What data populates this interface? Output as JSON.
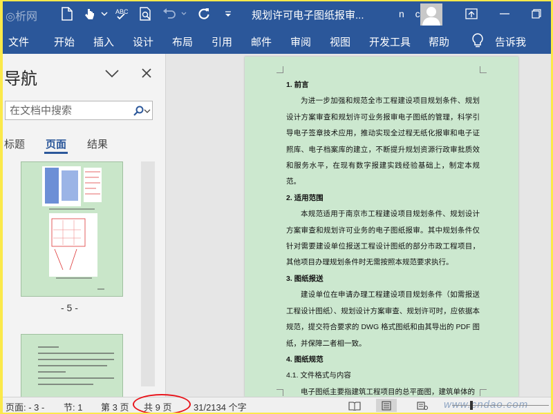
{
  "titlebar": {
    "doc_title": "规划许可电子图纸报审...",
    "user_initials": "n c",
    "logo_watermark": "◎析网"
  },
  "ribbon": {
    "tabs": [
      "文件",
      "开始",
      "插入",
      "设计",
      "布局",
      "引用",
      "邮件",
      "审阅",
      "视图",
      "开发工具",
      "帮助"
    ],
    "tell_me": "告诉我"
  },
  "nav": {
    "title": "导航",
    "search_placeholder": "在文档中搜索",
    "tabs": [
      "标题",
      "页面",
      "结果"
    ],
    "active_tab": "页面",
    "thumb_label": "- 5 -"
  },
  "document": {
    "paragraphs": [
      {
        "type": "h",
        "text": "1. 前言"
      },
      {
        "type": "p",
        "text": "为进一步加强和规范全市工程建设项目规划条件、规划设计方案审查和规划许可业务报审电子图纸的管理，科学引导电子签章技术应用，推动实现全过程无纸化报审和电子证照库、电子档案库的建立，不断提升规划资源行政审批质效和服务水平，在现有数字报建实践经验基础上，制定本规范。"
      },
      {
        "type": "h",
        "text": "2. 适用范围"
      },
      {
        "type": "p",
        "text": "本规范适用于南京市工程建设项目规划条件、规划设计方案审查和规划许可业务的电子图纸报审。其中规划条件仅针对需要建设单位报送工程设计图纸的部分市政工程项目，其他项目办理规划条件时无需按照本规范要求执行。"
      },
      {
        "type": "h",
        "text": "3. 图纸报送"
      },
      {
        "type": "p",
        "text": "建设单位在申请办理工程建设项目规划条件（如需报送工程设计图纸）、规划设计方案审查、规划许可时，应依据本规范，提交符合要求的 DWG 格式图纸和由其导出的 PDF 图纸，并保障二者相一致。"
      },
      {
        "type": "h",
        "text": "4. 图纸规范"
      },
      {
        "type": "s",
        "text": "4.1. 文件格式与内容"
      },
      {
        "type": "p",
        "text": "电子图纸主要指建筑工程项目的总平面图，建筑单体的"
      }
    ]
  },
  "status": {
    "page": "页面: - 3 -",
    "section": "节: 1",
    "page_of": "第 3 页",
    "total_pages": "共 9 页",
    "word_count": "31/2134 个字",
    "watermark": "www.cndao.com"
  },
  "colors": {
    "accent": "#2b579a",
    "page_bg": "#cce8cf",
    "highlight_oval": "#e8141b"
  }
}
